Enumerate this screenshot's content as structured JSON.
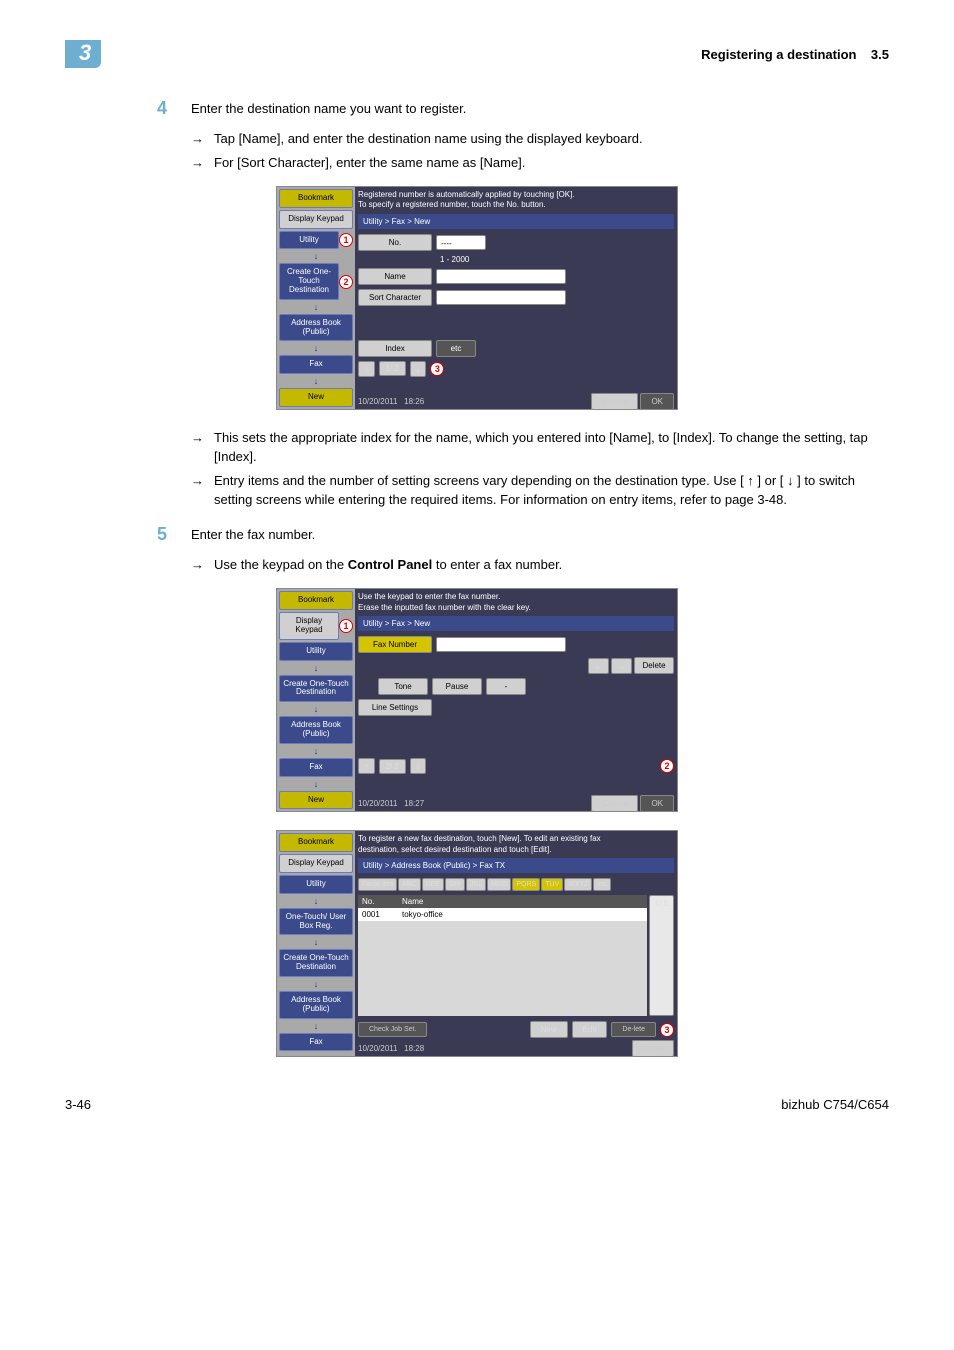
{
  "header": {
    "section_number": "3",
    "title": "Registering a destination",
    "section_ref": "3.5"
  },
  "step4": {
    "num": "4",
    "text": "Enter the destination name you want to register.",
    "subs": [
      "Tap [Name], and enter the destination name using the displayed keyboard.",
      "For [Sort Character], enter the same name as [Name]."
    ],
    "post_subs": [
      "This sets the appropriate index for the name, which you entered into [Name], to [Index]. To change the setting, tap [Index].",
      "Entry items and the number of setting screens vary depending on the destination type. Use [ ↑ ] or [ ↓ ] to switch setting screens while entering the required items. For information on entry items, refer to page 3-48."
    ]
  },
  "step5": {
    "num": "5",
    "text": "Enter the fax number.",
    "subs_prefix": "Use the keypad on the ",
    "subs_bold": "Control Panel",
    "subs_suffix": " to enter a fax number."
  },
  "ss1": {
    "msg1": "Registered number is automatically applied by touching [OK].",
    "msg2": "To specify a registered number, touch the No. button.",
    "breadcrumb": "Utility > Fax > New",
    "left": [
      "Bookmark",
      "Display Keypad",
      "Utility",
      "Create One-Touch Destination",
      "Address Book (Public)",
      "Fax",
      "New"
    ],
    "labels": {
      "no": "No.",
      "name": "Name",
      "sort": "Sort Character",
      "index": "Index",
      "etc": "etc"
    },
    "range": "1 - 2000",
    "no_val": "----",
    "page": "1/ 2",
    "footer_date": "10/20/2011",
    "footer_time": "18:26",
    "cancel": "Cancel",
    "ok": "OK"
  },
  "ss2": {
    "msg1": "Use the keypad to enter the fax number.",
    "msg2": "Erase the inputted fax number with the clear key.",
    "breadcrumb": "Utility > Fax > New",
    "left": [
      "Bookmark",
      "Display Keypad",
      "Utility",
      "Create One-Touch Destination",
      "Address Book (Public)",
      "Fax",
      "New"
    ],
    "labels": {
      "faxnum": "Fax Number",
      "tone": "Tone",
      "pause": "Pause",
      "dash": "-",
      "line": "Line Settings",
      "delete": "Delete"
    },
    "page": "2/ 2",
    "footer_date": "10/20/2011",
    "footer_time": "18:27",
    "cancel": "Cancel",
    "ok": "OK"
  },
  "ss3": {
    "msg1": "To register a new fax destination, touch [New]. To edit an existing fax",
    "msg2": "destination, select desired destination and touch [Edit].",
    "breadcrumb": "Utility > Address Book (Public) > Fax TX",
    "left": [
      "Bookmark",
      "Display Keypad",
      "Utility",
      "One-Touch/ User Box Reg.",
      "Create One-Touch Destination",
      "Address Book (Public)",
      "Fax"
    ],
    "tabs": [
      "Favor-ites",
      "ABC",
      "DEF",
      "GHI",
      "JKL",
      "MNO",
      "PQRS",
      "TUV",
      "WXYZ",
      "etc"
    ],
    "col_no": "No.",
    "col_name": "Name",
    "row_no": "0001",
    "row_name": "tokyo-office",
    "pager": "1/   1",
    "check": "Check Job Set.",
    "new": "New",
    "edit": "Edit",
    "delete": "De-lete",
    "footer_date": "10/20/2011",
    "footer_time": "18:28",
    "close": "Close"
  },
  "footer": {
    "page_num": "3-46",
    "model": "bizhub C754/C654"
  }
}
